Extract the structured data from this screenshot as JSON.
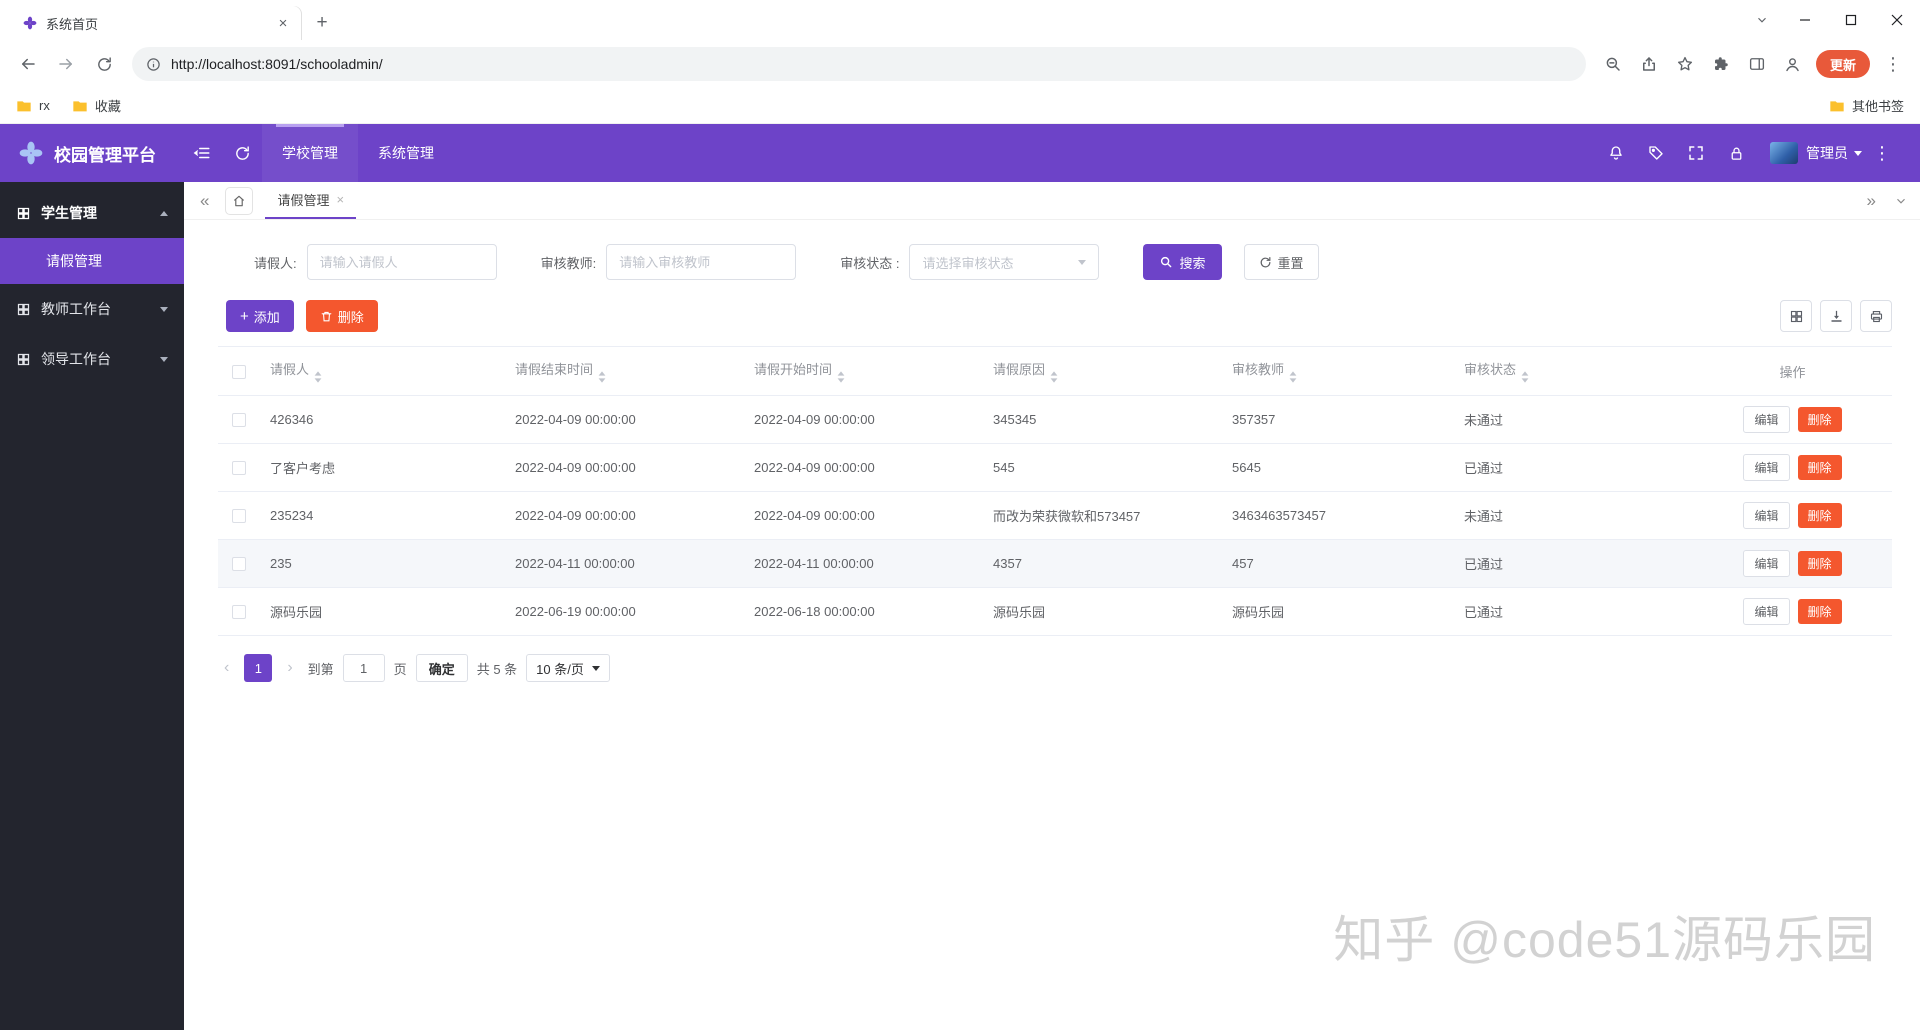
{
  "colors": {
    "primary": "#6d43c8",
    "danger": "#f4572e",
    "sidebar_bg": "#23252e",
    "update_pill": "#e8593a",
    "bookmark_folder": "#fbc02d"
  },
  "browser": {
    "tab_title": "系统首页",
    "url": "http://localhost:8091/schooladmin/",
    "bookmarks": [
      {
        "label": "rx"
      },
      {
        "label": "收藏"
      }
    ],
    "other_bookmarks": "其他书签",
    "update_label": "更新"
  },
  "header": {
    "brand": "校园管理平台",
    "nav": [
      {
        "label": "学校管理"
      },
      {
        "label": "系统管理"
      }
    ],
    "user_label": "管理员"
  },
  "sidebar": {
    "group1": "学生管理",
    "active_item": "请假管理",
    "group2": "教师工作台",
    "group3": "领导工作台"
  },
  "tabbar": {
    "tab": "请假管理"
  },
  "filters": {
    "person_label": "请假人:",
    "person_placeholder": "请输入请假人",
    "teacher_label": "审核教师:",
    "teacher_placeholder": "请输入审核教师",
    "status_label": "审核状态 :",
    "status_placeholder": "请选择审核状态",
    "search": "搜索",
    "reset": "重置"
  },
  "actions": {
    "add": "添加",
    "delete": "删除"
  },
  "table": {
    "headers": {
      "person": "请假人",
      "end_time": "请假结束时间",
      "start_time": "请假开始时间",
      "reason": "请假原因",
      "teacher": "审核教师",
      "status": "审核状态",
      "ops": "操作"
    },
    "edit": "编辑",
    "delete": "删除",
    "rows": [
      {
        "person": "426346",
        "end": "2022-04-09 00:00:00",
        "start": "2022-04-09 00:00:00",
        "reason": "345345",
        "teacher": "357357",
        "status": "未通过"
      },
      {
        "person": "了客户考虑",
        "end": "2022-04-09 00:00:00",
        "start": "2022-04-09 00:00:00",
        "reason": "545",
        "teacher": "5645",
        "status": "已通过"
      },
      {
        "person": "235234",
        "end": "2022-04-09 00:00:00",
        "start": "2022-04-09 00:00:00",
        "reason": "而改为荣获微软和573457",
        "teacher": "3463463573457",
        "status": "未通过"
      },
      {
        "person": "235",
        "end": "2022-04-11 00:00:00",
        "start": "2022-04-11 00:00:00",
        "reason": "4357",
        "teacher": "457",
        "status": "已通过"
      },
      {
        "person": "源码乐园",
        "end": "2022-06-19 00:00:00",
        "start": "2022-06-18 00:00:00",
        "reason": "源码乐园",
        "teacher": "源码乐园",
        "status": "已通过"
      }
    ]
  },
  "pagination": {
    "page": "1",
    "goto_prefix": "到第",
    "goto_value": "1",
    "goto_suffix": "页",
    "confirm": "确定",
    "total": "共 5 条",
    "size": "10 条/页"
  },
  "watermark": "知乎 @code51源码乐园"
}
